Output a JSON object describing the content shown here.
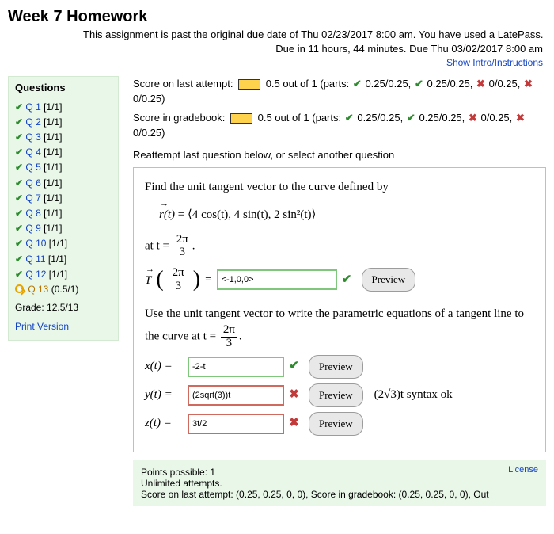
{
  "title": "Week 7 Homework",
  "due": {
    "line1": "This assignment is past the original due date of Thu 02/23/2017 8:00 am. You have used a LatePass.",
    "line2": "Due in 11 hours, 44 minutes. Due Thu 03/02/2017 8:00 am",
    "show_intro": "Show Intro/Instructions"
  },
  "sidebar": {
    "heading": "Questions",
    "items": [
      {
        "label": "Q 1",
        "score": "[1/1]",
        "status": "done"
      },
      {
        "label": "Q 2",
        "score": "[1/1]",
        "status": "done"
      },
      {
        "label": "Q 3",
        "score": "[1/1]",
        "status": "done"
      },
      {
        "label": "Q 4",
        "score": "[1/1]",
        "status": "done"
      },
      {
        "label": "Q 5",
        "score": "[1/1]",
        "status": "done"
      },
      {
        "label": "Q 6",
        "score": "[1/1]",
        "status": "done"
      },
      {
        "label": "Q 7",
        "score": "[1/1]",
        "status": "done"
      },
      {
        "label": "Q 8",
        "score": "[1/1]",
        "status": "done"
      },
      {
        "label": "Q 9",
        "score": "[1/1]",
        "status": "done"
      },
      {
        "label": "Q 10",
        "score": "[1/1]",
        "status": "done"
      },
      {
        "label": "Q 11",
        "score": "[1/1]",
        "status": "done"
      },
      {
        "label": "Q 12",
        "score": "[1/1]",
        "status": "done"
      },
      {
        "label": "Q 13",
        "score": "(0.5/1)",
        "status": "current"
      }
    ],
    "grade": "Grade: 12.5/13",
    "print": "Print Version"
  },
  "scores": {
    "last_attempt_label": "Score on last attempt:",
    "last_attempt_value": "0.5 out of 1 (parts:",
    "last_parts": [
      {
        "ok": true,
        "text": "0.25/0.25,"
      },
      {
        "ok": true,
        "text": "0.25/0.25,"
      },
      {
        "ok": false,
        "text": "0/0.25,"
      },
      {
        "ok": false,
        "text": "0/0.25)"
      }
    ],
    "gradebook_label": "Score in gradebook:",
    "gradebook_value": "0.5 out of 1 (parts:",
    "gradebook_parts": [
      {
        "ok": true,
        "text": "0.25/0.25,"
      },
      {
        "ok": true,
        "text": "0.25/0.25,"
      },
      {
        "ok": false,
        "text": "0/0.25,"
      },
      {
        "ok": false,
        "text": "0/0.25)"
      }
    ],
    "reattempt": "Reattempt last question below, or select another question"
  },
  "problem": {
    "intro": "Find the unit tangent vector to the curve defined by",
    "r_expr": " = ⟨4 cos(t), 4 sin(t), 2 sin²(t)⟩",
    "at_label": "at t =",
    "frac_num": "2π",
    "frac_den": "3",
    "tangent_label": "T",
    "input1_value": "<-1,0,0>",
    "para_intro": "Use the unit tangent vector to write the parametric equations of a tangent line to the curve at t =",
    "xt": "x(t)  =",
    "yt": "y(t)  =",
    "zt": "z(t)  =",
    "input_xt": "-2-t",
    "input_yt": "(2sqrt(3))t",
    "input_zt": "3t/2",
    "preview": "Preview",
    "syntax_hint_pre": "(2√3)t",
    "syntax_hint_post": " syntax ok"
  },
  "footer": {
    "points": "Points possible: 1",
    "attempts": "Unlimited attempts.",
    "summary": "Score on last attempt: (0.25, 0.25, 0, 0), Score in gradebook: (0.25, 0.25, 0, 0), Out",
    "license": "License"
  }
}
